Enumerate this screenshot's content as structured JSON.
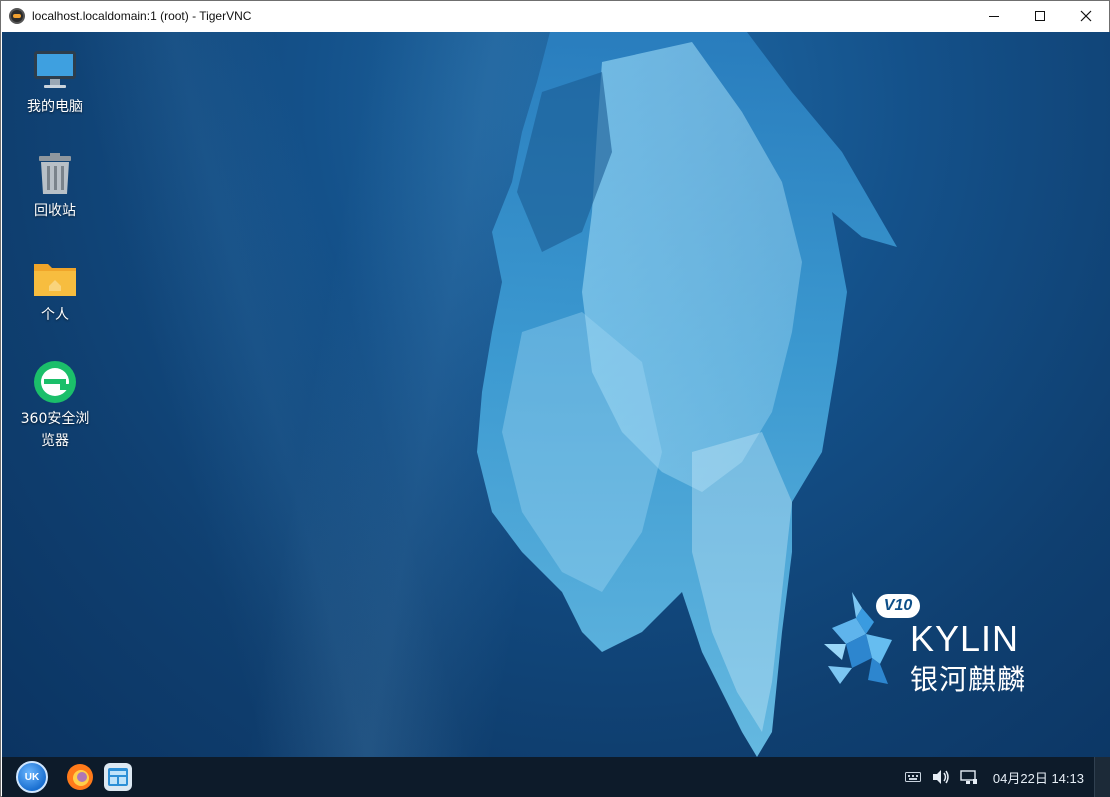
{
  "window": {
    "title": "localhost.localdomain:1 (root) - TigerVNC",
    "minimize": "–",
    "maximize": "□",
    "close": "✕"
  },
  "desktop": {
    "icons": [
      {
        "label": "我的电脑",
        "icon": "computer-icon"
      },
      {
        "label": "回收站",
        "icon": "trash-icon"
      },
      {
        "label": "个人",
        "icon": "home-folder-icon"
      },
      {
        "label": "360安全浏\n览器",
        "icon": "browser-icon"
      }
    ],
    "logo": {
      "version": "V10",
      "name": "KYLIN",
      "name_cn": "银河麒麟"
    }
  },
  "taskbar": {
    "start_label": "UK",
    "apps": [
      {
        "name": "firefox",
        "icon": "firefox-icon"
      },
      {
        "name": "file-manager",
        "icon": "file-manager-icon"
      }
    ],
    "clock": "04月22日 14:13"
  },
  "colors": {
    "desktop_bg": "#14518a",
    "taskbar_bg": "#0d1b2a"
  }
}
